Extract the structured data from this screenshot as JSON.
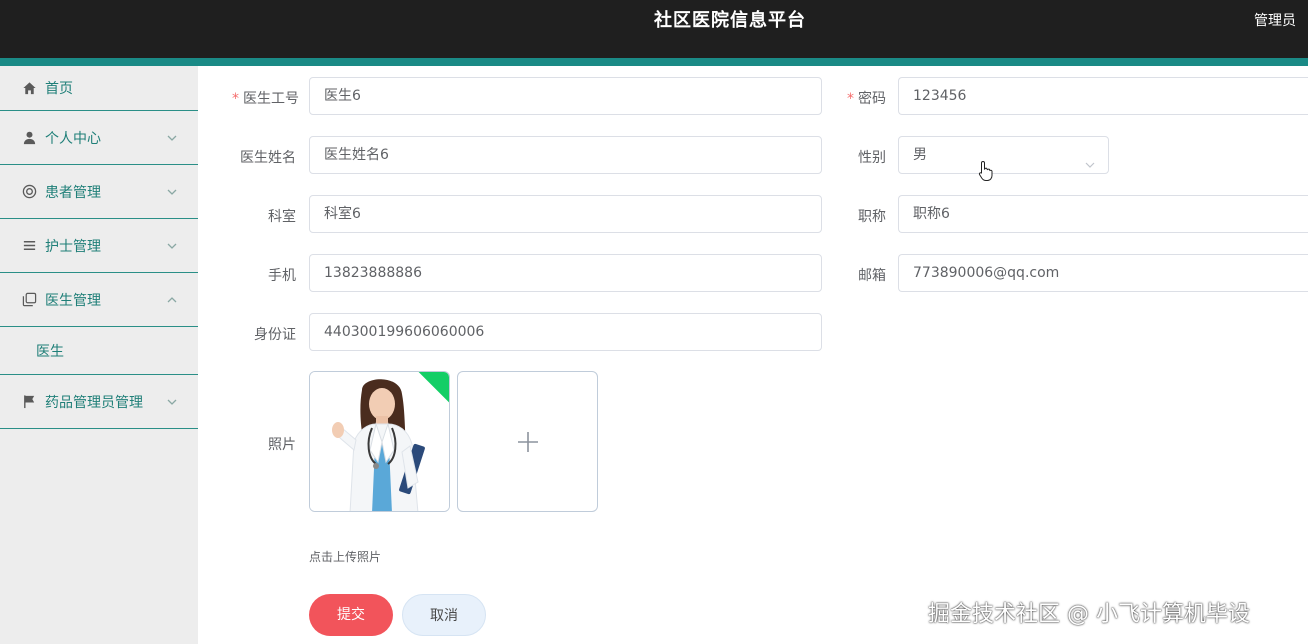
{
  "header": {
    "title": "社区医院信息平台",
    "user": "管理员"
  },
  "sidebar": {
    "items": [
      {
        "label": "首页",
        "icon": "home-icon"
      },
      {
        "label": "个人中心",
        "icon": "user-icon"
      },
      {
        "label": "患者管理",
        "icon": "patient-icon"
      },
      {
        "label": "护士管理",
        "icon": "list-icon"
      },
      {
        "label": "医生管理",
        "icon": "copy-icon",
        "expanded": true,
        "children": [
          {
            "label": "医生"
          }
        ]
      },
      {
        "label": "药品管理员管理",
        "icon": "flag-icon"
      }
    ]
  },
  "form": {
    "doctor_id": {
      "label": "医生工号",
      "value": "医生6",
      "required": true
    },
    "password": {
      "label": "密码",
      "value": "123456",
      "required": true
    },
    "doctor_name": {
      "label": "医生姓名",
      "value": "医生姓名6"
    },
    "gender": {
      "label": "性别",
      "value": "男"
    },
    "department": {
      "label": "科室",
      "value": "科室6"
    },
    "title": {
      "label": "职称",
      "value": "职称6"
    },
    "phone": {
      "label": "手机",
      "value": "13823888886"
    },
    "email": {
      "label": "邮箱",
      "value": "773890006@qq.com"
    },
    "id_card": {
      "label": "身份证",
      "value": "440300199606060006"
    },
    "photo": {
      "label": "照片",
      "tip": "点击上传照片"
    }
  },
  "buttons": {
    "submit": "提交",
    "cancel": "取消"
  },
  "watermark": "掘金技术社区 @ 小飞计算机毕设",
  "colors": {
    "header_bg": "#1f1f1f",
    "accent": "#1a8a86",
    "menu_text": "#1f7f78",
    "submit": "#f2545b",
    "success": "#13ce66"
  }
}
